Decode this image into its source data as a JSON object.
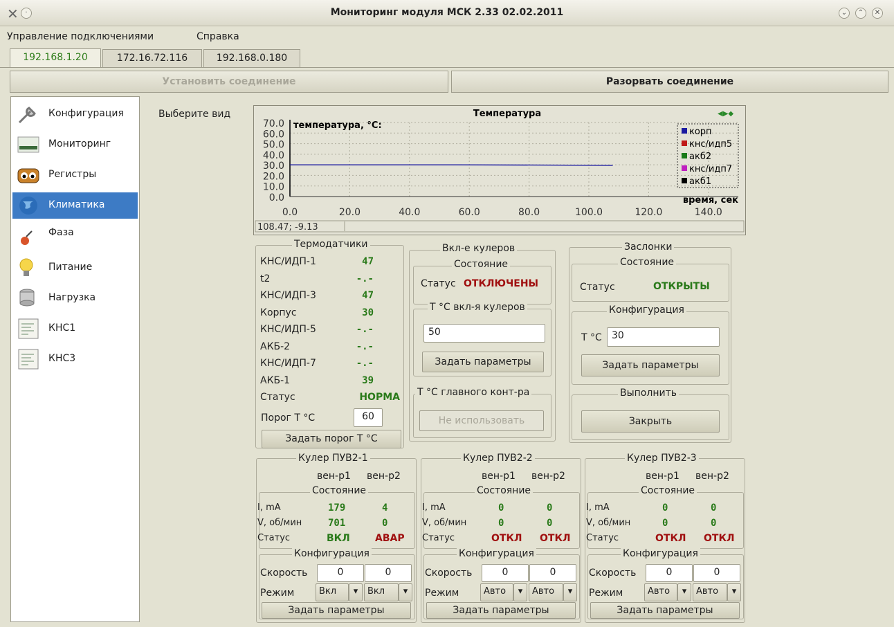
{
  "window": {
    "title": "Мониторинг модуля МСК 2.33 02.02.2011"
  },
  "menu": [
    "Управление подключениями",
    "Справка"
  ],
  "tabs": [
    "192.168.1.20",
    "172.16.72.116",
    "192.168.0.180"
  ],
  "connect": {
    "label": "Установить соединение"
  },
  "disconnect": {
    "label": "Разорвать соединение"
  },
  "sidebar": {
    "items": [
      {
        "label": "Конфигурация",
        "icon": "wrench-icon"
      },
      {
        "label": "Мониторинг",
        "icon": "board-icon"
      },
      {
        "label": "Регистры",
        "icon": "eyes-icon"
      },
      {
        "label": "Климатика",
        "icon": "globe-icon"
      },
      {
        "label": "Фаза",
        "icon": "phase-icon"
      },
      {
        "label": "Питание",
        "icon": "bulb-icon"
      },
      {
        "label": "Нагрузка",
        "icon": "server-icon"
      },
      {
        "label": "КНС1",
        "icon": "document-icon"
      },
      {
        "label": "КНС3",
        "icon": "document-icon"
      }
    ]
  },
  "view_label": "Выберите вид",
  "colors": {
    "accent": "#3d7bc5",
    "ok": "#2a7a1a",
    "alarm": "#a01010"
  },
  "chart": {
    "coords": "108.47; -9.13"
  },
  "chart_data": {
    "type": "line",
    "title": "Температура",
    "ylabel": "температура, °C:",
    "xlabel": "время, сек",
    "xlim": [
      0,
      150
    ],
    "ylim": [
      0,
      70
    ],
    "yticks": [
      "70.0",
      "60.0",
      "50.0",
      "40.0",
      "30.0",
      "20.0",
      "10.0",
      "0.0"
    ],
    "xticks": [
      "0.0",
      "20.0",
      "40.0",
      "60.0",
      "80.0",
      "100.0",
      "120.0",
      "140.0"
    ],
    "legend_position": "top-right",
    "series": [
      {
        "name": "корп",
        "color": "#1a1aa0",
        "x": [
          0,
          56,
          108
        ],
        "y": [
          30,
          30,
          29.5
        ]
      },
      {
        "name": "кнс/идп5",
        "color": "#c01818",
        "x": [],
        "y": []
      },
      {
        "name": "акб2",
        "color": "#1a7a1a",
        "x": [],
        "y": []
      },
      {
        "name": "кнс/идп7",
        "color": "#c020c0",
        "x": [],
        "y": []
      },
      {
        "name": "акб1",
        "color": "#000000",
        "x": [],
        "y": []
      }
    ]
  },
  "thermo": {
    "title": "Термодатчики",
    "rows": [
      {
        "label": "КНС/ИДП-1",
        "value": "47"
      },
      {
        "label": "t2",
        "value": "-.-"
      },
      {
        "label": "КНС/ИДП-3",
        "value": "47"
      },
      {
        "label": "Корпус",
        "value": "30"
      },
      {
        "label": "КНС/ИДП-5",
        "value": "-.-"
      },
      {
        "label": "АКБ-2",
        "value": "-.-"
      },
      {
        "label": "КНС/ИДП-7",
        "value": "-.-"
      },
      {
        "label": "АКБ-1",
        "value": "39"
      },
      {
        "label": "Статус",
        "value": "НОРМА"
      }
    ],
    "threshold_label": "Порог T °C",
    "threshold_value": "60",
    "set_threshold": "Задать порог T °C"
  },
  "coolers": {
    "title": "Вкл-е кулеров",
    "state_title": "Состояние",
    "status_label": "Статус",
    "status_value": "ОТКЛЮЧЕНЫ",
    "temp_title": "T °C вкл-я кулеров",
    "temp_value": "50",
    "set_params": "Задать параметры",
    "main_title": "T °C главного конт-ра",
    "not_use": "Не использовать"
  },
  "dampers": {
    "title": "Заслонки",
    "state_title": "Состояние",
    "status_label": "Статус",
    "status_value": "ОТКРЫТЫ",
    "config_title": "Конфигурация",
    "temp_label": "T °C",
    "temp_value": "30",
    "set_params": "Задать параметры",
    "exec_title": "Выполнить",
    "close": "Закрыть"
  },
  "fans": [
    {
      "title": "Кулер ПУВ2-1",
      "col1": "вен-р1",
      "col2": "вен-р2",
      "state": "Состояние",
      "i_label": "I, mA",
      "i1": "179",
      "i2": "4",
      "v_label": "V, об/мин",
      "v1": "701",
      "v2": "0",
      "s_label": "Статус",
      "s1": "ВКЛ",
      "s2": "АВАР",
      "config": "Конфигурация",
      "speed_label": "Скорость",
      "sp1": "0",
      "sp2": "0",
      "mode_label": "Режим",
      "m1": "Вкл",
      "m2": "Вкл",
      "set": "Задать параметры"
    },
    {
      "title": "Кулер ПУВ2-2",
      "col1": "вен-р1",
      "col2": "вен-р2",
      "state": "Состояние",
      "i_label": "I, mA",
      "i1": "0",
      "i2": "0",
      "v_label": "V, об/мин",
      "v1": "0",
      "v2": "0",
      "s_label": "Статус",
      "s1": "ОТКЛ",
      "s2": "ОТКЛ",
      "config": "Конфигурация",
      "speed_label": "Скорость",
      "sp1": "0",
      "sp2": "0",
      "mode_label": "Режим",
      "m1": "Авто",
      "m2": "Авто",
      "set": "Задать параметры"
    },
    {
      "title": "Кулер ПУВ2-3",
      "col1": "вен-р1",
      "col2": "вен-р2",
      "state": "Состояние",
      "i_label": "I, mA",
      "i1": "0",
      "i2": "0",
      "v_label": "V, об/мин",
      "v1": "0",
      "v2": "0",
      "s_label": "Статус",
      "s1": "ОТКЛ",
      "s2": "ОТКЛ",
      "config": "Конфигурация",
      "speed_label": "Скорость",
      "sp1": "0",
      "sp2": "0",
      "mode_label": "Режим",
      "m1": "Авто",
      "m2": "Авто",
      "set": "Задать параметры"
    }
  ]
}
